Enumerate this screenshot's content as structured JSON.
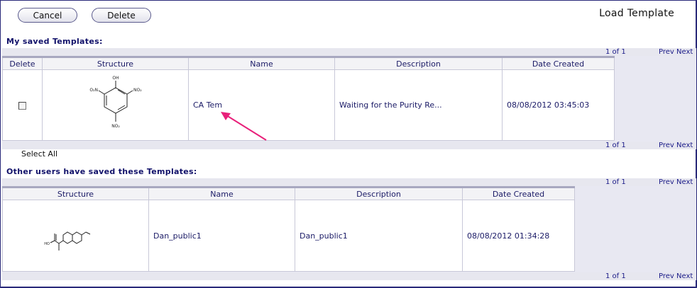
{
  "toolbar": {
    "cancel_label": "Cancel",
    "delete_label": "Delete"
  },
  "page": {
    "title": "Load Template"
  },
  "my_templates": {
    "heading": "My saved Templates:",
    "pager": {
      "count": "1 of 1",
      "prev": "Prev",
      "next": "Next"
    },
    "columns": {
      "delete": "Delete",
      "structure": "Structure",
      "name": "Name",
      "description": "Description",
      "date_created": "Date Created"
    },
    "rows": [
      {
        "name": "CA Tem",
        "description": "Waiting for the Purity Re...",
        "date_created": "08/08/2012 03:45:03",
        "structure_labels": {
          "oh": "OH",
          "no2_left": "O₂N",
          "no2_right": "NO₂",
          "no2_bottom": "NO₂"
        }
      }
    ],
    "select_all_label": "Select All"
  },
  "other_templates": {
    "heading": "Other users have saved these Templates:",
    "pager": {
      "count": "1 of 1",
      "prev": "Prev",
      "next": "Next"
    },
    "columns": {
      "structure": "Structure",
      "name": "Name",
      "description": "Description",
      "date_created": "Date Created"
    },
    "rows": [
      {
        "name": "Dan_public1",
        "description": "Dan_public1",
        "date_created": "08/08/2012 01:34:28",
        "structure_labels": {
          "ho": "HO"
        }
      }
    ]
  },
  "colors": {
    "annotation_arrow": "#e8207a",
    "link_text": "#1a1a66",
    "header_bar": "#e7e7ef"
  }
}
